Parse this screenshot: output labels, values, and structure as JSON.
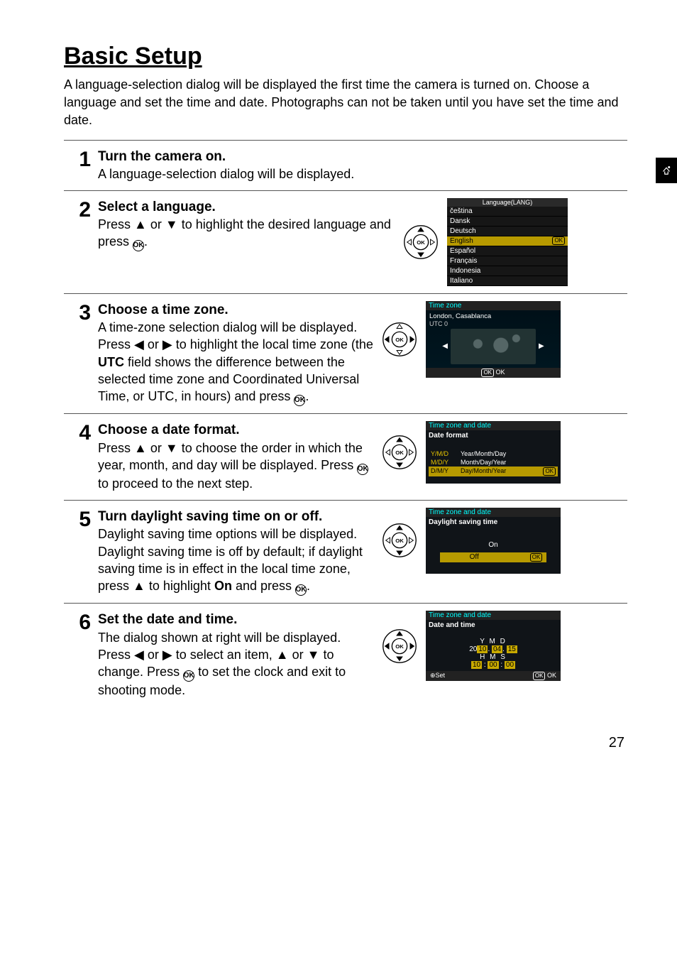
{
  "page": {
    "title": "Basic Setup",
    "intro": "A language-selection dialog will be displayed the first time the camera is turned on.  Choose a language and set the time and date.  Photographs can not be taken until you have set the time and date.",
    "number": "27"
  },
  "glyphs": {
    "up": "▲",
    "down": "▼",
    "left": "◀",
    "right": "▶",
    "ok": "k"
  },
  "steps": {
    "s1": {
      "num": "1",
      "title": "Turn the camera on.",
      "text": "A language-selection dialog will be displayed."
    },
    "s2": {
      "num": "2",
      "title": "Select a language.",
      "text_pre": "Press ",
      "text_mid": " or ",
      "text_post": " to highlight the desired language and press ",
      "text_end": "."
    },
    "s3": {
      "num": "3",
      "title": "Choose a time zone.",
      "text_a": "A time-zone selection dialog will be displayed.  Press ",
      "text_b": " or ",
      "text_c": " to highlight the local time zone (the ",
      "utc_label": "UTC",
      "text_d": " field shows the difference between the selected time zone and Coordinated Universal Time, or UTC, in hours) and press ",
      "text_e": "."
    },
    "s4": {
      "num": "4",
      "title": "Choose a date format.",
      "text_a": "Press ",
      "text_b": " or ",
      "text_c": " to choose the order in which the year, month, and day will be displayed.  Press ",
      "text_d": " to proceed to the next step."
    },
    "s5": {
      "num": "5",
      "title": "Turn daylight saving time on or off.",
      "text_a": "Daylight saving time options will be displayed.  Daylight saving time is off by default; if daylight saving time is in effect in the local time zone, press ",
      "text_b": " to highlight ",
      "on_label": "On",
      "text_c": " and press ",
      "text_d": "."
    },
    "s6": {
      "num": "6",
      "title": "Set the date and time.",
      "text_a": "The dialog shown at right will be displayed.  Press ",
      "text_b": " or ",
      "text_c": " to select an item, ",
      "text_d": " or ",
      "text_e": " to change.  Press ",
      "text_f": " to set the clock and exit to shooting mode."
    }
  },
  "screens": {
    "lang": {
      "title": "Language(LANG)",
      "items": [
        "čeština",
        "Dansk",
        "Deutsch",
        "English",
        "Español",
        "Français",
        "Indonesia",
        "Italiano"
      ],
      "selected": "English",
      "ok": "OK"
    },
    "tz": {
      "head": "Time zone",
      "loc": "London, Casablanca",
      "utc": "UTC  0",
      "foot_ok": "OK",
      "foot_label": "OK"
    },
    "df": {
      "head": "Time zone and date",
      "sub": "Date format",
      "opts": [
        {
          "code": "Y/M/D",
          "lbl": "Year/Month/Day"
        },
        {
          "code": "M/D/Y",
          "lbl": "Month/Day/Year"
        },
        {
          "code": "D/M/Y",
          "lbl": "Day/Month/Year"
        }
      ],
      "selected_code": "D/M/Y",
      "ok": "OK"
    },
    "dst": {
      "head": "Time zone and date",
      "sub": "Daylight saving time",
      "on": "On",
      "off": "Off",
      "ok": "OK"
    },
    "dt": {
      "head": "Time zone and date",
      "sub": "Date and time",
      "ymd_labels": "Y    M    D",
      "ymd_vals_pre": "20",
      "ymd_y": "10",
      "ymd_sep1": ". ",
      "ymd_m": "04",
      "ymd_sep2": ". ",
      "ymd_d": "15",
      "hms_labels": "H    M    S",
      "hms_h": "10",
      "hms_sep1": " : ",
      "hms_m": "00",
      "hms_sep2": " : ",
      "hms_s": "00",
      "foot_set": "Set",
      "foot_ok": "OK",
      "foot_ok2": "OK"
    }
  }
}
